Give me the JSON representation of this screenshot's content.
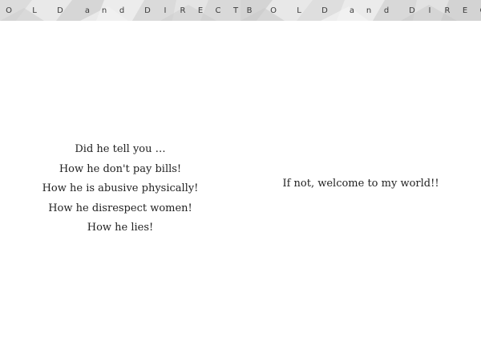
{
  "left_page": {
    "header_letters": [
      "O",
      "L",
      "D",
      "a",
      "n",
      "d",
      "D",
      "I",
      "R",
      "E",
      "C",
      "T"
    ],
    "lines": [
      "Did he tell you …",
      "How he don't pay bills!",
      "How he is abusive physically!",
      "How he disrespect women!",
      "How he lies!"
    ]
  },
  "right_page": {
    "header_letters": [
      "B",
      "O",
      "L",
      "D",
      "a",
      "n",
      "d",
      "D",
      "I",
      "R",
      "E",
      "C"
    ],
    "lines": [
      "If not, welcome to my world!!"
    ]
  },
  "colors": {
    "header_background": "#e6e6e6",
    "header_text": "#3a3a3a",
    "body_text": "#222222"
  }
}
